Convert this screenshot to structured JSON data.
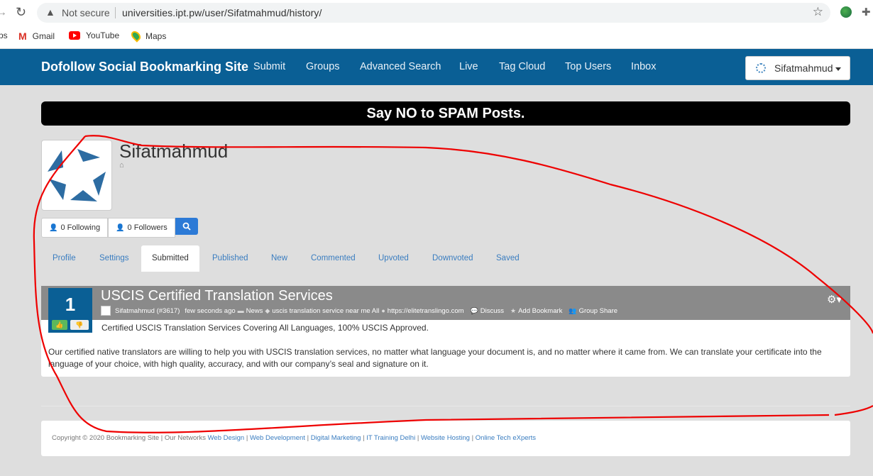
{
  "browser": {
    "security_label": "Not secure",
    "url": "universities.ipt.pw/user/Sifatmahmud/history/",
    "bookmarks": [
      {
        "label": "Gmail",
        "icon": "gmail-icon"
      },
      {
        "label": "YouTube",
        "icon": "youtube-icon"
      },
      {
        "label": "Maps",
        "icon": "maps-icon"
      }
    ],
    "bookmarks_prefix": "ps"
  },
  "site": {
    "brand": "Dofollow Social Bookmarking Site",
    "nav": [
      "Submit",
      "Groups",
      "Advanced Search",
      "Live",
      "Tag Cloud",
      "Top Users",
      "Inbox"
    ],
    "user": "Sifatmahmud",
    "brand_color": "#0a5f95"
  },
  "banner": "Say NO to SPAM Posts.",
  "profile": {
    "name": "Sifatmahmud",
    "following": "0 Following",
    "followers": "0 Followers"
  },
  "tabs": [
    "Profile",
    "Settings",
    "Submitted",
    "Published",
    "New",
    "Commented",
    "Upvoted",
    "Downvoted",
    "Saved"
  ],
  "active_tab": "Submitted",
  "story": {
    "votes": "1",
    "title": "USCIS Certified Translation Services",
    "author": "Sifatmahmud (#3617)",
    "time": "few seconds ago",
    "category": "News",
    "tags": "uscis translation service near me All",
    "link": "https://elitetranslingo.com",
    "discuss": "Discuss",
    "add_bookmark": "Add Bookmark",
    "group_share": "Group Share",
    "summary": "Certified USCIS Translation Services Covering All Languages, 100% USCIS Approved.",
    "body": "Our certified native translators are willing to help you with USCIS translation services, no matter what language your document is, and no matter where it came from. We can translate your certificate into the language of your choice, with high quality, accuracy, and with our company’s seal and signature on it."
  },
  "footer": {
    "copyright": "Copyright © 2020 Bookmarking Site | Our Networks",
    "links": [
      "Web Design",
      "Web Development",
      "Digital Marketing",
      "IT Training Delhi",
      "Website Hosting",
      "Online Tech eXperts"
    ]
  }
}
